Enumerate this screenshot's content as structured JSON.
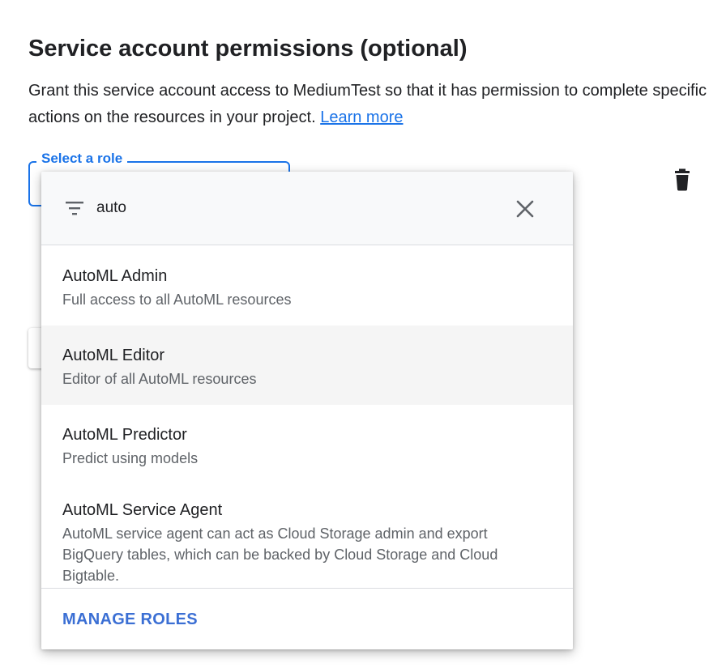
{
  "section": {
    "title": "Service account permissions (optional)",
    "description": "Grant this service account access to MediumTest so that it has permission to complete specific actions on the resources in your project.",
    "learn_more": "Learn more"
  },
  "role_field": {
    "label": "Select a role"
  },
  "dropdown": {
    "search_value": "auto",
    "options": [
      {
        "title": "AutoML Admin",
        "description": "Full access to all AutoML resources"
      },
      {
        "title": "AutoML Editor",
        "description": "Editor of all AutoML resources"
      },
      {
        "title": "AutoML Predictor",
        "description": "Predict using models"
      },
      {
        "title": "AutoML Service Agent",
        "description": "AutoML service agent can act as Cloud Storage admin and export BigQuery tables, which can be backed by Cloud Storage and Cloud Bigtable."
      }
    ],
    "manage_roles": "MANAGE ROLES"
  },
  "icons": {
    "delete": "trash-icon",
    "filter": "filter-icon",
    "clear": "close-icon"
  },
  "colors": {
    "accent": "#1a73e8",
    "highlight": "#f5f5f5"
  }
}
